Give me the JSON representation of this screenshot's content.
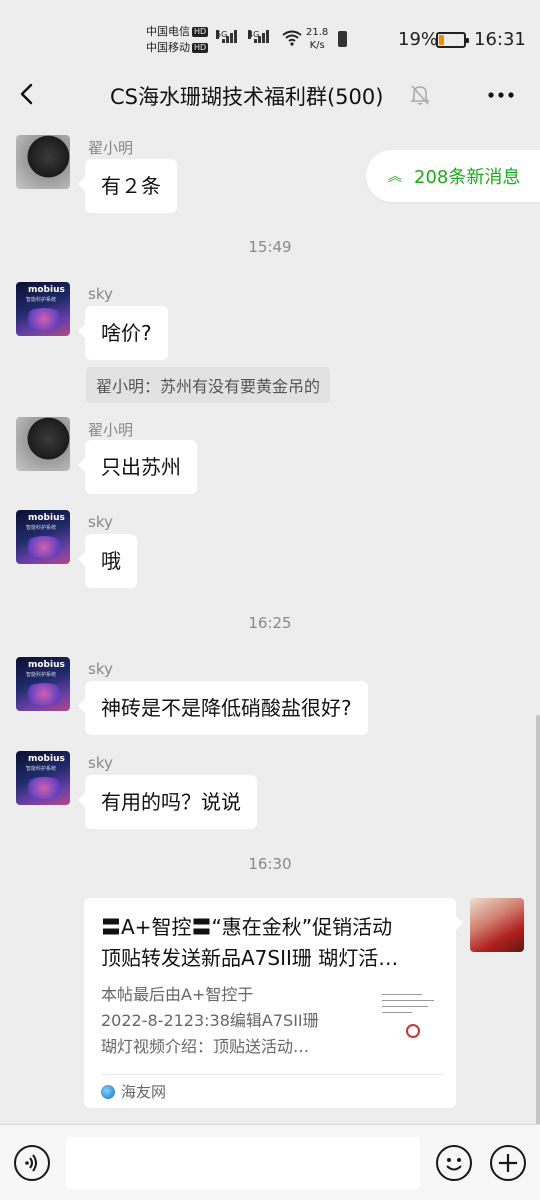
{
  "status_bar": {
    "carrier1": "中国电信",
    "carrier2": "中国移动",
    "hd_badge": "HD",
    "sim1_network": "5G",
    "sim2_network": "4G",
    "net_speed_value": "21.8",
    "net_speed_unit": "K/s",
    "battery_percent": "19%",
    "battery_level": 0.19,
    "time": "16:31"
  },
  "header": {
    "title": "CS海水珊瑚技术福利群(500)",
    "back_icon": "chevron-left-icon",
    "mute_icon": "bell-off-icon",
    "more_icon": "more-dots-icon"
  },
  "new_messages_pill": {
    "label": "208条新消息",
    "icon": "double-chevron-up-icon"
  },
  "messages": [
    {
      "type": "text",
      "sender": "翟小明",
      "avatar": "black-cat",
      "text": "有２条"
    },
    {
      "type": "time",
      "text": "15:49"
    },
    {
      "type": "text",
      "sender": "sky",
      "avatar": "mobius",
      "text": "啥价?",
      "quote": "翟小明：苏州有没有要黄金吊的"
    },
    {
      "type": "text",
      "sender": "翟小明",
      "avatar": "black-cat",
      "text": "只出苏州"
    },
    {
      "type": "text",
      "sender": "sky",
      "avatar": "mobius",
      "text": "哦"
    },
    {
      "type": "time",
      "text": "16:25"
    },
    {
      "type": "text",
      "sender": "sky",
      "avatar": "mobius",
      "text": "神砖是不是降低硝酸盐很好?"
    },
    {
      "type": "text",
      "sender": "sky",
      "avatar": "mobius",
      "text": "有用的吗？说说"
    },
    {
      "type": "time",
      "text": "16:30"
    }
  ],
  "avatar_labels": {
    "mobius_brand": "mobius",
    "mobius_sub": "智能科护系统"
  },
  "link_card": {
    "title_line1": "〓A+智控〓“惠在金秋”促销活动",
    "title_line2": "顶贴转发送新品A7SII珊 瑚灯活…",
    "desc_line1": "本帖最后由A+智控于",
    "desc_line2": "2022-8-2123:38编辑A7SII珊",
    "desc_line3": "瑚灯视频介绍：顶贴送活动…",
    "source": "海友网"
  },
  "input_bar": {
    "voice_icon": "voice-icon",
    "emoji_icon": "emoji-smile-icon",
    "plus_icon": "plus-circle-icon",
    "placeholder": ""
  },
  "colors": {
    "accent_green": "#1aad19",
    "background": "#ededed",
    "battery_low": "#f08c00"
  }
}
